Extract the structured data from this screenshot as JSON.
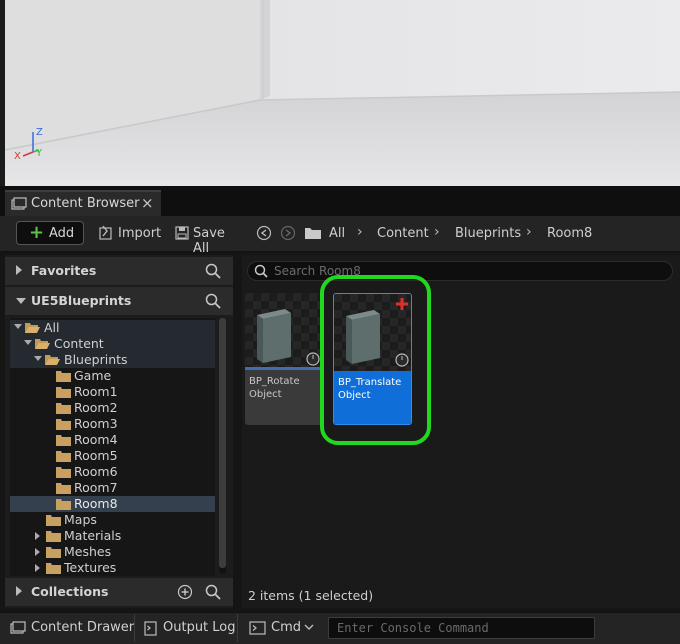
{
  "viewport": {
    "gizmo": {
      "z_label": "Z",
      "y_label": "Y",
      "x_label": "X"
    }
  },
  "tab": {
    "label": "Content Browser",
    "close": "×",
    "icon": "folder-stack-icon"
  },
  "toolbar": {
    "add_label": "Add",
    "import_label": "Import",
    "save_all_label": "Save All",
    "breadcrumbs": [
      "All",
      "Content",
      "Blueprints",
      "Room8"
    ]
  },
  "left_panel": {
    "favorites_label": "Favorites",
    "project_label": "UE5Blueprints",
    "collections_label": "Collections",
    "tree": [
      {
        "label": "All"
      },
      {
        "label": "Content"
      },
      {
        "label": "Blueprints"
      },
      {
        "label": "Game"
      },
      {
        "label": "Room1"
      },
      {
        "label": "Room2"
      },
      {
        "label": "Room3"
      },
      {
        "label": "Room4"
      },
      {
        "label": "Room5"
      },
      {
        "label": "Room6"
      },
      {
        "label": "Room7"
      },
      {
        "label": "Room8",
        "selected": true
      },
      {
        "label": "Maps"
      },
      {
        "label": "Materials"
      },
      {
        "label": "Meshes"
      },
      {
        "label": "Textures"
      }
    ]
  },
  "content": {
    "search_placeholder": "Search Room8",
    "assets": [
      {
        "name": "BP_Rotate\nObject",
        "selected": false
      },
      {
        "name": "BP_Translate\nObject",
        "selected": true
      }
    ],
    "status": "2 items (1 selected)"
  },
  "bottom_bar": {
    "content_drawer_label": "Content Drawer",
    "output_log_label": "Output Log",
    "cmd_label": "Cmd",
    "console_placeholder": "Enter Console Command"
  },
  "colors": {
    "selection_blue": "#0f6ed8",
    "highlight_green": "#22d81e",
    "add_green": "#5ec24a",
    "new_asset_red": "#e0302a"
  }
}
